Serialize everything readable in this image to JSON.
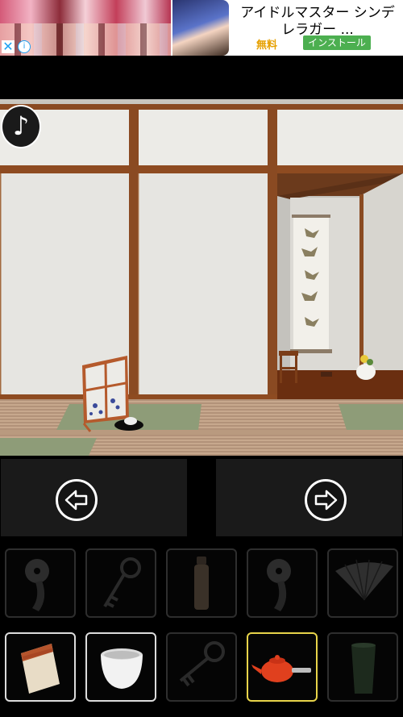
{
  "ad": {
    "title": "アイドルマスター シンデレラガー ...",
    "free_label": "無料",
    "install_label": "インストール",
    "close_glyph": "✕",
    "info_glyph": "i"
  },
  "scene": {
    "music_glyph": "♪"
  },
  "navigation": {
    "left_icon": "arrow-left-icon",
    "right_icon": "arrow-right-icon"
  },
  "inventory": {
    "rows": [
      [
        {
          "name": "round-key-dim",
          "state": "dim"
        },
        {
          "name": "key-dim",
          "state": "dim"
        },
        {
          "name": "bottle-dim",
          "state": "dim"
        },
        {
          "name": "round-key-dim",
          "state": "dim"
        },
        {
          "name": "folding-fan-dim",
          "state": "dim"
        }
      ],
      [
        {
          "name": "matchbox",
          "state": "available"
        },
        {
          "name": "teacup",
          "state": "available"
        },
        {
          "name": "key-dim",
          "state": "dim"
        },
        {
          "name": "teapot",
          "state": "selected"
        },
        {
          "name": "cup-dim",
          "state": "dim"
        }
      ]
    ],
    "colors": {
      "selected_border": "#e8d44a",
      "available_border": "#dcdcdc",
      "dim_border": "#2e2e2e"
    }
  }
}
